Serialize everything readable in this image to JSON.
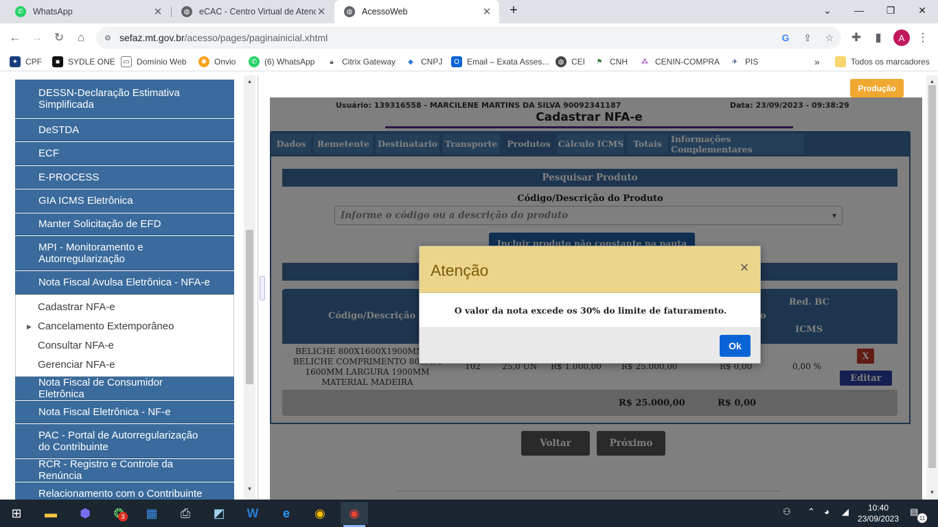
{
  "browser": {
    "tabs": [
      {
        "title": "WhatsApp",
        "icon": "whatsapp-icon"
      },
      {
        "title": "eCAC - Centro Virtual de Atendim",
        "icon": "globe-icon"
      },
      {
        "title": "AcessoWeb",
        "icon": "globe-icon"
      }
    ],
    "url_host": "sefaz.mt.gov.br",
    "url_path": "/acesso/pages/paginainicial.xhtml",
    "avatar_letter": "A",
    "bookmarks": [
      {
        "label": "CPF"
      },
      {
        "label": "SYDLE ONE"
      },
      {
        "label": "Domínio Web"
      },
      {
        "label": "Onvio"
      },
      {
        "label": "(6) WhatsApp"
      },
      {
        "label": "Citrix Gateway"
      },
      {
        "label": "CNPJ"
      },
      {
        "label": "Email – Exata Asses..."
      },
      {
        "label": "CEI"
      },
      {
        "label": "CNH"
      },
      {
        "label": "CENIN-COMPRA"
      },
      {
        "label": "PIS"
      }
    ],
    "all_bookmarks": "Todos os marcadores"
  },
  "menu": {
    "items": [
      "DESSN-Declaração Estimativa Simplificada",
      "DeSTDA",
      "ECF",
      "E-PROCESS",
      "GIA ICMS Eletrônica",
      "Manter Solicitação de EFD",
      "MPI - Monitoramento e Autorregularização",
      "Nota Fiscal Avulsa Eletrônica - NFA-e",
      "Nota Fiscal de Consumidor Eletrônica",
      "Nota Fiscal Eletrônica - NF-e",
      "PAC - Portal de Autorregularização do Contribuinte",
      "RCR - Registro e Controle da Renúncia",
      "Relacionamento com o Contribuinte"
    ],
    "subitems": [
      "Cadastrar NFA-e",
      "Cancelamento Extemporâneo",
      "Consultar NFA-e",
      "Gerenciar NFA-e"
    ]
  },
  "content": {
    "badge": "Produção",
    "user": "Usuário: 139316558 - MARCILENE MARTINS DA SILVA 90092341187",
    "date": "Data: 23/09/2023 - 09:38:29",
    "title": "Cadastrar NFA-e",
    "tabs": [
      "Dados",
      "Remetente",
      "Destinatario",
      "Transporte",
      "Produtos",
      "Cálculo ICMS",
      "Totais",
      "Informações Complementares"
    ],
    "search_header": "Pesquisar Produto",
    "search_label": "Código/Descrição do Produto",
    "search_placeholder": "Informe o código ou a descrição do produto",
    "include_button": "Incluir produto não constante na pauta",
    "grid": {
      "col_code": "Código/Descrição",
      "col_partial": "o",
      "col_red_bc": "Red. BC",
      "col_icms": "ICMS",
      "row": {
        "description": "BELICHE 800X1600X1900MM CA BELICHE COMPRIMENTO 800MM 1600MM LARGURA 1900MM MATERIAL MADEIRA",
        "cfop": "102",
        "quantity": "25,0 UN",
        "unit_value": "R$ 1.000,00",
        "total_value": "R$ 25.000,00",
        "icms_value": "R$ 0,00",
        "red_bc": "0,00 %",
        "delete_label": "X",
        "edit_label": "Editar"
      },
      "total_value": "R$ 25.000,00",
      "total_icms": "R$ 0,00"
    },
    "back_button": "Voltar",
    "next_button": "Próximo"
  },
  "modal": {
    "title": "Atenção",
    "message": "O valor da nota excede os 30% do limite de faturamento.",
    "ok": "Ok",
    "close": "×"
  },
  "taskbar": {
    "time": "10:40",
    "date": "23/09/2023",
    "notifications": "11",
    "badge": "3"
  }
}
